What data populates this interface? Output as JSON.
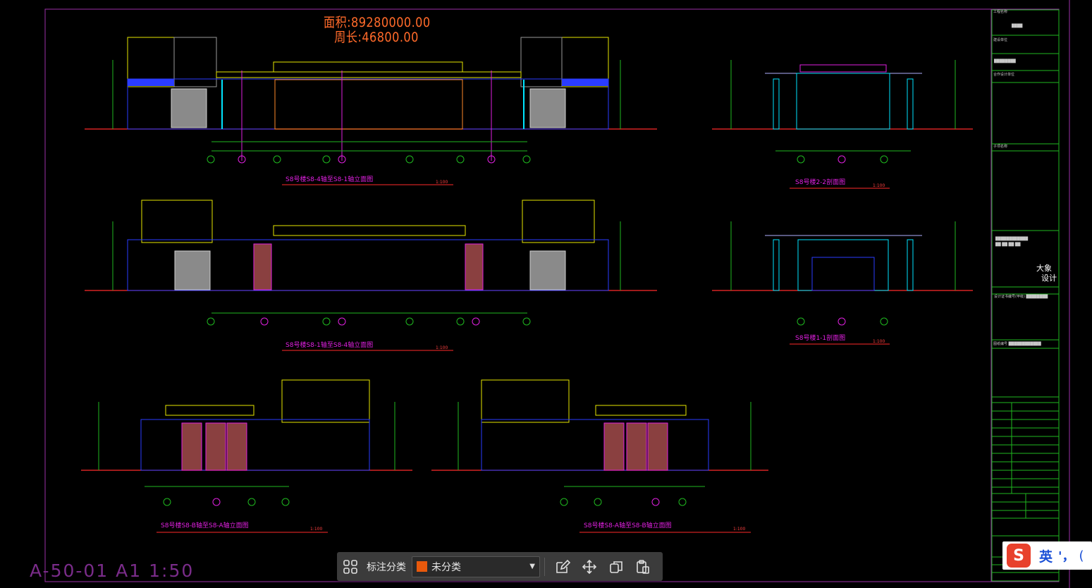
{
  "drawing": {
    "area_label": "面积:89280000.00",
    "perimeter_label": "周长:46800.00",
    "sheet_code": "A-50-01 A1 1:50",
    "views": [
      {
        "title": "S8号楼S8-4轴至S8-1轴立面图",
        "scale": "1:100"
      },
      {
        "title": "S8号楼2-2剖面图",
        "scale": "1:100"
      },
      {
        "title": "S8号楼S8-1轴至S8-4轴立面图",
        "scale": "1:100"
      },
      {
        "title": "S8号楼1-1剖面图",
        "scale": "1:100"
      },
      {
        "title": "S8号楼S8-B轴至S8-A轴立面图",
        "scale": "1:100"
      },
      {
        "title": "S8号楼S8-A轴至S8-B轴立面图",
        "scale": "1:100"
      }
    ],
    "title_block": {
      "logo_text_1": "大象",
      "logo_text_2": "设计"
    }
  },
  "toolbar": {
    "category_label": "标注分类",
    "selected_category": "未分类",
    "swatch_color": "#e8590c",
    "icons": [
      "grid-icon",
      "edit-icon",
      "move-icon",
      "copy-icon",
      "paste-icon"
    ]
  },
  "ime": {
    "mode": "英",
    "punct": "'，",
    "more": "("
  }
}
